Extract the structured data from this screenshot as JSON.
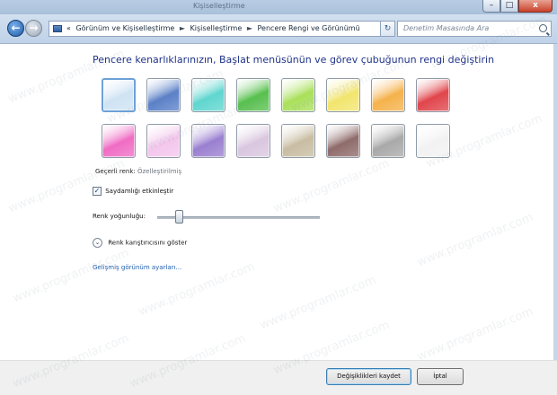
{
  "window": {
    "title": "Kişiselleştirme",
    "buttons": {
      "minimize": "–",
      "maximize": "□",
      "close": "x"
    }
  },
  "nav": {
    "back_glyph": "←",
    "forward_glyph": "→",
    "address": {
      "prefix": "«",
      "crumbs": [
        "Görünüm ve Kişiselleştirme",
        "Kişiselleştirme",
        "Pencere Rengi ve Görünümü"
      ],
      "separator": "►",
      "dropdown": "▼"
    },
    "refresh_glyph": "↻",
    "search_placeholder": "Denetim Masasında Ara"
  },
  "main": {
    "heading": "Pencere kenarlıklarınızın, Başlat menüsünün ve görev çubuğunun rengi değiştirin",
    "current_color_label": "Geçerli renk:",
    "current_color_value": "Özelleştirilmiş",
    "transparency": {
      "label": "Saydamlığı etkinleştir",
      "checked": true,
      "glyph": "✓"
    },
    "intensity_label": "Renk yoğunluğu:",
    "intensity_value": 0.13,
    "mixer_toggle_label": "Renk karıştırıcısını göster",
    "mixer_glyph": "⌄",
    "advanced_link": "Gelişmiş görünüm ayarları..."
  },
  "swatches": [
    {
      "name": "sky",
      "color": "#cfe3f4"
    },
    {
      "name": "twilight",
      "color": "#5a80c8"
    },
    {
      "name": "sea",
      "color": "#5fd6cf"
    },
    {
      "name": "leaf",
      "color": "#57c04d"
    },
    {
      "name": "lime",
      "color": "#a9e05a"
    },
    {
      "name": "lightning",
      "color": "#f2e56e"
    },
    {
      "name": "pumpkin",
      "color": "#f5b24b"
    },
    {
      "name": "ruby",
      "color": "#e0454b"
    },
    {
      "name": "fuchsia",
      "color": "#f06cc4"
    },
    {
      "name": "blush",
      "color": "#f3c6ec"
    },
    {
      "name": "violet",
      "color": "#9a7fd0"
    },
    {
      "name": "lavender",
      "color": "#d9c6df"
    },
    {
      "name": "taupe",
      "color": "#c8bda2"
    },
    {
      "name": "chocolate",
      "color": "#8f6b6b"
    },
    {
      "name": "slate",
      "color": "#a9a9a9"
    },
    {
      "name": "frost",
      "color": "#f2f2f2"
    }
  ],
  "footer": {
    "save_label": "Değişiklikleri kaydet",
    "cancel_label": "İptal"
  },
  "watermark_text": "www.programlar.com"
}
